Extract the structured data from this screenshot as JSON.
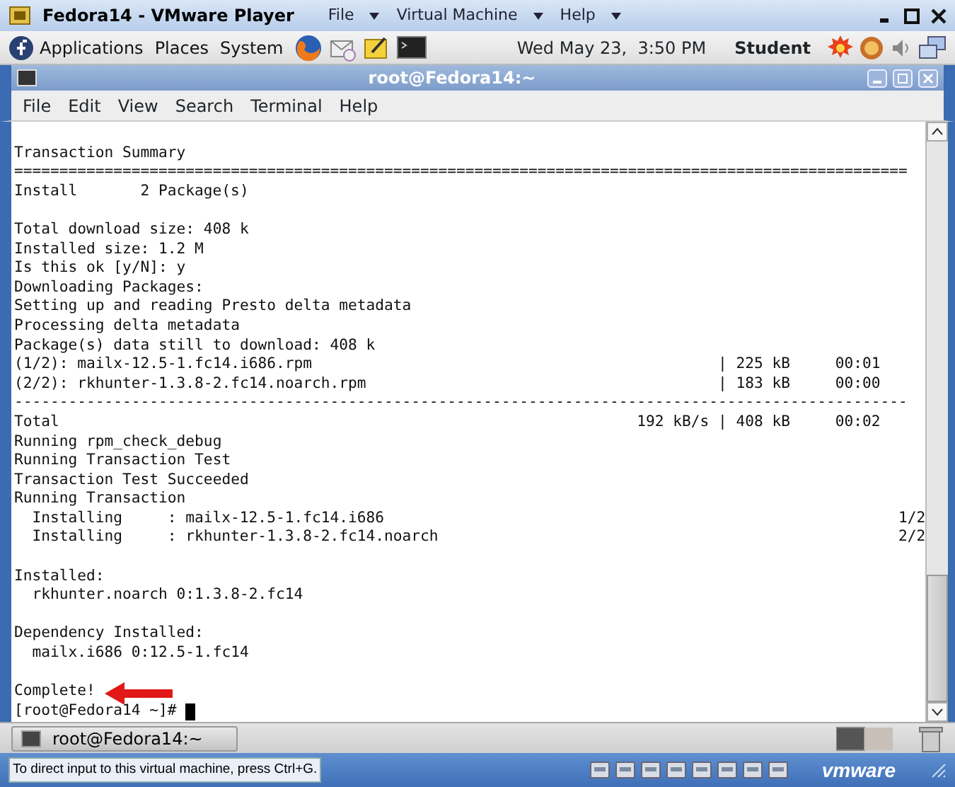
{
  "player": {
    "title": "Fedora14 - VMware Player",
    "menus": [
      {
        "label": "File"
      },
      {
        "label": "Virtual Machine"
      },
      {
        "label": "Help"
      }
    ]
  },
  "top_panel": {
    "menus": [
      "Applications",
      "Places",
      "System"
    ],
    "clock": "Wed May 23,  3:50 PM",
    "user": "Student"
  },
  "terminal": {
    "title": "root@Fedora14:~",
    "menu": [
      "File",
      "Edit",
      "View",
      "Search",
      "Terminal",
      "Help"
    ],
    "lines": [
      {
        "kind": "blank",
        "marked": false
      },
      {
        "kind": "text",
        "text": "Transaction Summary",
        "marked": false
      },
      {
        "kind": "text",
        "text": "===================================================================================================",
        "marked": false
      },
      {
        "kind": "pair",
        "left": "Install",
        "right": "2 Package(s)",
        "marked": false
      },
      {
        "kind": "blank",
        "marked": false
      },
      {
        "kind": "text",
        "text": "Total download size: 408 k",
        "marked": false
      },
      {
        "kind": "text",
        "text": "Installed size: 1.2 M",
        "marked": false
      },
      {
        "kind": "text",
        "text": "Is this ok [y/N]: y",
        "marked": false
      },
      {
        "kind": "text",
        "text": "Downloading Packages:",
        "marked": false
      },
      {
        "kind": "text",
        "text": "Setting up and reading Presto delta metadata",
        "marked": false
      },
      {
        "kind": "text",
        "text": "Processing delta metadata",
        "marked": false
      },
      {
        "kind": "text",
        "text": "Package(s) data still to download: 408 k",
        "marked": false
      },
      {
        "kind": "download",
        "file": "(1/2): mailx-12.5-1.fc14.i686.rpm",
        "size": "| 225 kB",
        "time": "00:01",
        "marked": false
      },
      {
        "kind": "download",
        "file": "(2/2): rkhunter-1.3.8-2.fc14.noarch.rpm",
        "size": "| 183 kB",
        "time": "00:00",
        "marked": false
      },
      {
        "kind": "text",
        "text": "---------------------------------------------------------------------------------------------------",
        "marked": false
      },
      {
        "kind": "total",
        "file": "Total",
        "rate": "192 kB/s",
        "size": "| 408 kB",
        "time": "00:02",
        "marked": false
      },
      {
        "kind": "text",
        "text": "Running rpm_check_debug",
        "marked": false
      },
      {
        "kind": "text",
        "text": "Running Transaction Test",
        "marked": false
      },
      {
        "kind": "text",
        "text": "Transaction Test Succeeded",
        "marked": false
      },
      {
        "kind": "text",
        "text": "Running Transaction",
        "marked": false
      },
      {
        "kind": "step",
        "action": "Installing",
        "package": ": mailx-12.5-1.fc14.i686",
        "progress": "1/2",
        "marked": false
      },
      {
        "kind": "step",
        "action": "Installing",
        "package": ": rkhunter-1.3.8-2.fc14.noarch",
        "progress": "2/2",
        "marked": false
      },
      {
        "kind": "blank",
        "marked": false
      },
      {
        "kind": "text",
        "text": "Installed:",
        "marked": false
      },
      {
        "kind": "text",
        "text": "  rkhunter.noarch 0:1.3.8-2.fc14",
        "marked": false
      },
      {
        "kind": "blank",
        "marked": false
      },
      {
        "kind": "text",
        "text": "Dependency Installed:",
        "marked": false
      },
      {
        "kind": "text",
        "text": "  mailx.i686 0:12.5-1.fc14",
        "marked": false
      },
      {
        "kind": "blank",
        "marked": false
      },
      {
        "kind": "text",
        "text": "Complete!",
        "marked": true
      },
      {
        "kind": "prompt",
        "text": "[root@Fedora14 ~]#",
        "marked": false
      }
    ]
  },
  "bottom_panel": {
    "task": "root@Fedora14:~"
  },
  "status_bar": {
    "hint": "To direct input to this virtual machine, press Ctrl+G.",
    "brand": "vmware"
  }
}
